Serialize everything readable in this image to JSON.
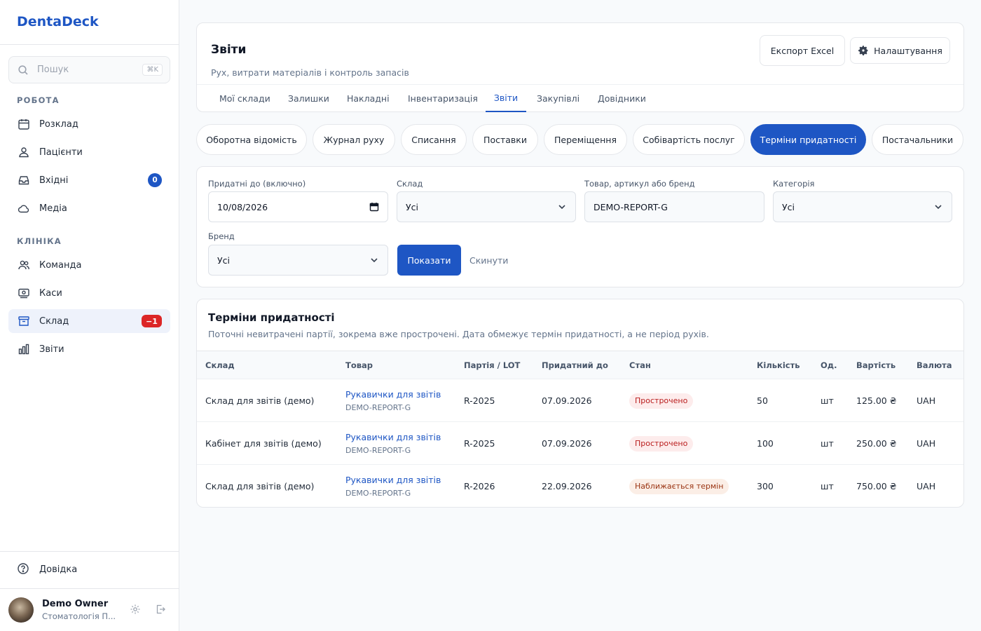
{
  "app": {
    "name": "DentaDeck"
  },
  "search": {
    "placeholder": "Пошук",
    "shortcut": "⌘K"
  },
  "sidebar": {
    "sections": [
      {
        "title": "РОБОТА",
        "items": [
          {
            "label": "Розклад",
            "icon": "calendar-icon"
          },
          {
            "label": "Пацієнти",
            "icon": "users-icon"
          },
          {
            "label": "Вхідні",
            "icon": "inbox-icon",
            "badge": "0"
          },
          {
            "label": "Медіа",
            "icon": "cloud-icon"
          }
        ]
      },
      {
        "title": "КЛІНІКА",
        "items": [
          {
            "label": "Команда",
            "icon": "team-icon"
          },
          {
            "label": "Каси",
            "icon": "cash-register-icon"
          },
          {
            "label": "Склад",
            "icon": "archive-box-icon",
            "badge": "−1",
            "active": true
          },
          {
            "label": "Звіти",
            "icon": "bar-chart-icon"
          }
        ]
      }
    ],
    "help_label": "Довідка",
    "user": {
      "name": "Demo Owner",
      "org": "Стоматологія П..."
    }
  },
  "header": {
    "title": "Звіти",
    "subtitle": "Рух, витрати матеріалів і контроль запасів",
    "export_label": "Експорт Excel",
    "settings_label": "Налаштування",
    "tabs": [
      "Мої склади",
      "Залишки",
      "Накладні",
      "Інвентаризація",
      "Звіти",
      "Закупівлі",
      "Довідники"
    ],
    "active_tab": "Звіти"
  },
  "report_pills": [
    "Оборотна відомість",
    "Журнал руху",
    "Списання",
    "Поставки",
    "Переміщення",
    "Собівартість послуг",
    "Терміни придатності",
    "Постачальники"
  ],
  "active_pill": "Терміни придатності",
  "filters": {
    "valid_until": {
      "label": "Придатні до (включно)",
      "value": "10/08/2026"
    },
    "warehouse": {
      "label": "Склад",
      "value": "Усі"
    },
    "product": {
      "label": "Товар, артикул або бренд",
      "value": "DEMO-REPORT-G"
    },
    "category": {
      "label": "Категорія",
      "value": "Усі"
    },
    "brand": {
      "label": "Бренд",
      "value": "Усі"
    },
    "show_label": "Показати",
    "reset_label": "Скинути"
  },
  "report": {
    "title": "Терміни придатності",
    "subtitle": "Поточні невитрачені партії, зокрема вже прострочені. Дата обмежує термін придатності, а не період рухів.",
    "columns": [
      "Склад",
      "Товар",
      "Партія / LOT",
      "Придатний до",
      "Стан",
      "Кількість",
      "Од.",
      "Вартість",
      "Валюта"
    ],
    "rows": [
      {
        "warehouse": "Склад для звітів (демо)",
        "product": "Рукавички для звітів",
        "sku": "DEMO-REPORT-G",
        "lot": "R-2025",
        "expiry": "07.09.2026",
        "status": "Прострочено",
        "status_type": "expired",
        "qty": "50",
        "unit": "шт",
        "cost": "125.00 ₴",
        "currency": "UAH"
      },
      {
        "warehouse": "Кабінет для звітів (демо)",
        "product": "Рукавички для звітів",
        "sku": "DEMO-REPORT-G",
        "lot": "R-2025",
        "expiry": "07.09.2026",
        "status": "Прострочено",
        "status_type": "expired",
        "qty": "100",
        "unit": "шт",
        "cost": "250.00 ₴",
        "currency": "UAH"
      },
      {
        "warehouse": "Склад для звітів (демо)",
        "product": "Рукавички для звітів",
        "sku": "DEMO-REPORT-G",
        "lot": "R-2026",
        "expiry": "22.09.2026",
        "status": "Наближається термін",
        "status_type": "soon",
        "qty": "300",
        "unit": "шт",
        "cost": "750.00 ₴",
        "currency": "UAH"
      }
    ]
  },
  "colors": {
    "primary": "#1e56c4",
    "danger": "#dc2626",
    "expired_bg": "#fdecec",
    "soon_bg": "#fbeee6"
  }
}
